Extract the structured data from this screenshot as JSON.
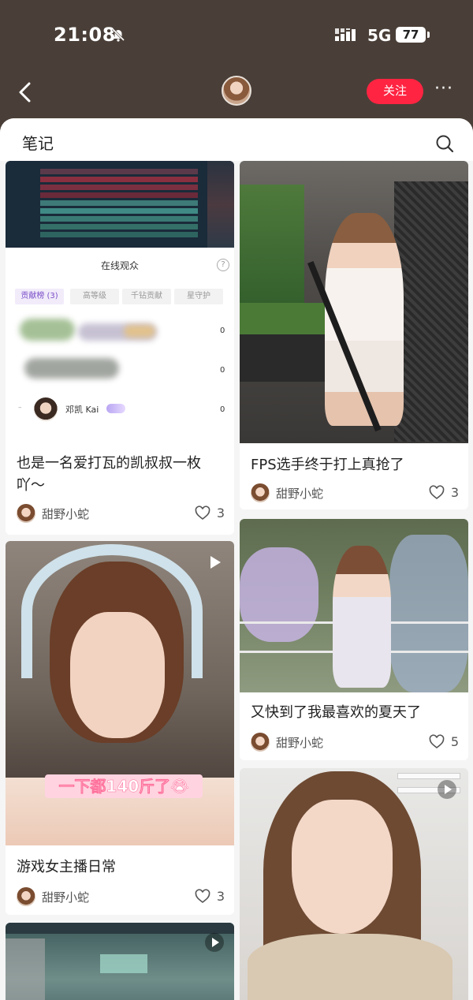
{
  "status": {
    "time": "21:08",
    "network": "5G",
    "battery": "77"
  },
  "nav": {
    "follow_label": "关注",
    "more": "···"
  },
  "section": {
    "title": "笔记"
  },
  "viewer_panel": {
    "title": "在线观众",
    "help": "?",
    "tabs": [
      "贡献榜 (3)",
      "高等级",
      "千钻贡献",
      "星守护"
    ],
    "zeros": [
      "0",
      "0",
      "0"
    ],
    "dash": "–",
    "user_name": "邓凯 Kai"
  },
  "cards": [
    {
      "title_line1": "也是一名爱打瓦的凯叔叔一枚",
      "title_line2": "吖～",
      "author": "甜野小蛇",
      "likes": "3"
    },
    {
      "title": "FPS选手终于打上真抢了",
      "author": "甜野小蛇",
      "likes": "3"
    },
    {
      "title": "游戏女主播日常",
      "author": "甜野小蛇",
      "likes": "3",
      "caption": "一下都140斤了😭"
    },
    {
      "title": "又快到了我最喜欢的夏天了",
      "author": "甜野小蛇",
      "likes": "5"
    }
  ],
  "colors": {
    "brand_red": "#ff2442",
    "header_bg": "#4a3f38",
    "sheet_bg": "#f5f5f5"
  }
}
